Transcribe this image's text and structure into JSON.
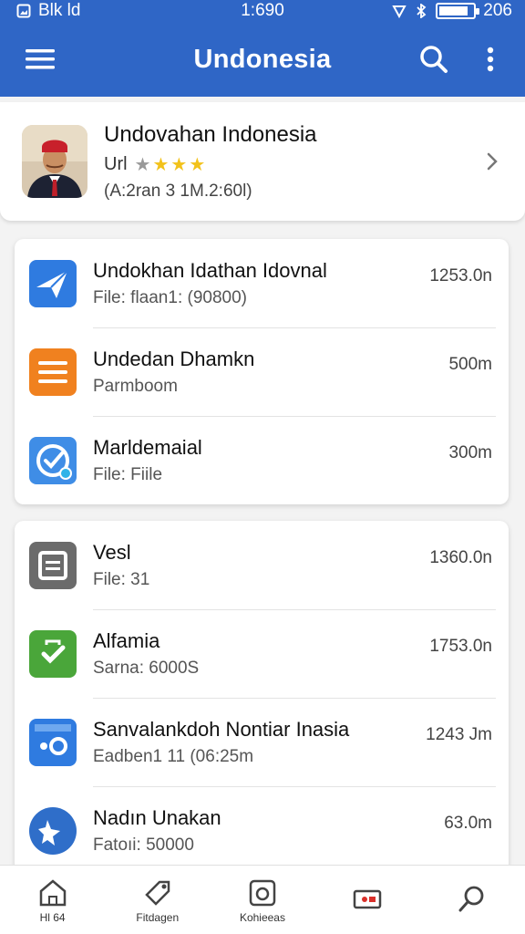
{
  "status_bar": {
    "left_text": "Blk ld",
    "time": "1:690",
    "battery_text": "206",
    "battery_level": 0.85
  },
  "app_bar": {
    "title": "Undonesia"
  },
  "profile": {
    "name": "Undovahan Indonesia",
    "rating_label": "Url",
    "stars": 4,
    "rating_max": 4,
    "meta": "(A:2ran 3 1M.2:60l)"
  },
  "list1": [
    {
      "title": "Undokhan Idathan Idovnal",
      "subtitle": "File: flaan1: (90800)",
      "size": "1253.0n",
      "icon": "paper-plane-icon",
      "color": "#2f7be0"
    },
    {
      "title": "Undedan Dhamkn",
      "subtitle": "Parmboom",
      "size": "500m",
      "icon": "document-lines-icon",
      "color": "#f0811f"
    },
    {
      "title": "Marldemaial",
      "subtitle": "File: Fiile",
      "size": "300m",
      "icon": "check-circle-icon",
      "color": "#3f8de6"
    }
  ],
  "list2": [
    {
      "title": "Vesl",
      "subtitle": "File: 31",
      "size": "1360.0n",
      "icon": "note-icon",
      "color": "#6b6b6b"
    },
    {
      "title": "Alfamia",
      "subtitle": "Sarna: 6000S",
      "size": "1753.0n",
      "icon": "bag-check-icon",
      "color": "#4aa63a"
    },
    {
      "title": "Sanvalankdoh Nontiar Inasia",
      "subtitle": "Eadben1 11 (06:25m",
      "size": "1243 Jm",
      "icon": "calendar-icon",
      "color": "#2f7be0"
    },
    {
      "title": "Nadın Unakan",
      "subtitle": "Fatoıi: 50000",
      "size": "63.0m",
      "icon": "star-badge-icon",
      "color": "#2f6ec9"
    }
  ],
  "bottom_nav": [
    {
      "label": "Hl 64",
      "icon": "home-icon"
    },
    {
      "label": "Fitdagen",
      "icon": "tag-icon"
    },
    {
      "label": "Kohieeas",
      "icon": "camera-icon"
    },
    {
      "label": "",
      "icon": "tv-icon"
    },
    {
      "label": "",
      "icon": "search-icon"
    }
  ]
}
